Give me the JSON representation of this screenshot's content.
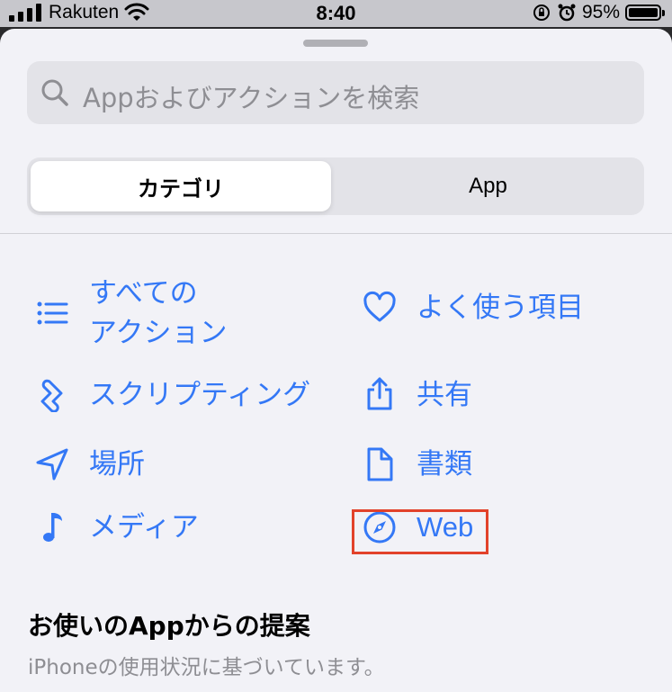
{
  "status_bar": {
    "carrier": "Rakuten",
    "time": "8:40",
    "battery": "95%",
    "battery_level": 0.95
  },
  "search": {
    "placeholder": "Appおよびアクションを検索"
  },
  "segmented": {
    "selected": "カテゴリ",
    "other": "App"
  },
  "categories": [
    {
      "label_line1": "すべての",
      "label_line2": "アクション",
      "icon": "list-icon"
    },
    {
      "label": "よく使う項目",
      "icon": "heart-icon"
    },
    {
      "label": "スクリプティング",
      "icon": "scripting-icon"
    },
    {
      "label": "共有",
      "icon": "share-icon"
    },
    {
      "label": "場所",
      "icon": "location-icon"
    },
    {
      "label": "書類",
      "icon": "document-icon"
    },
    {
      "label": "メディア",
      "icon": "music-note-icon"
    },
    {
      "label": "Web",
      "icon": "compass-icon"
    }
  ],
  "highlight_color": "#e2422b",
  "accent_color": "#3478f6",
  "suggestions": {
    "title": "お使いのAppからの提案",
    "subtitle": "iPhoneの使用状況に基づいています。"
  }
}
